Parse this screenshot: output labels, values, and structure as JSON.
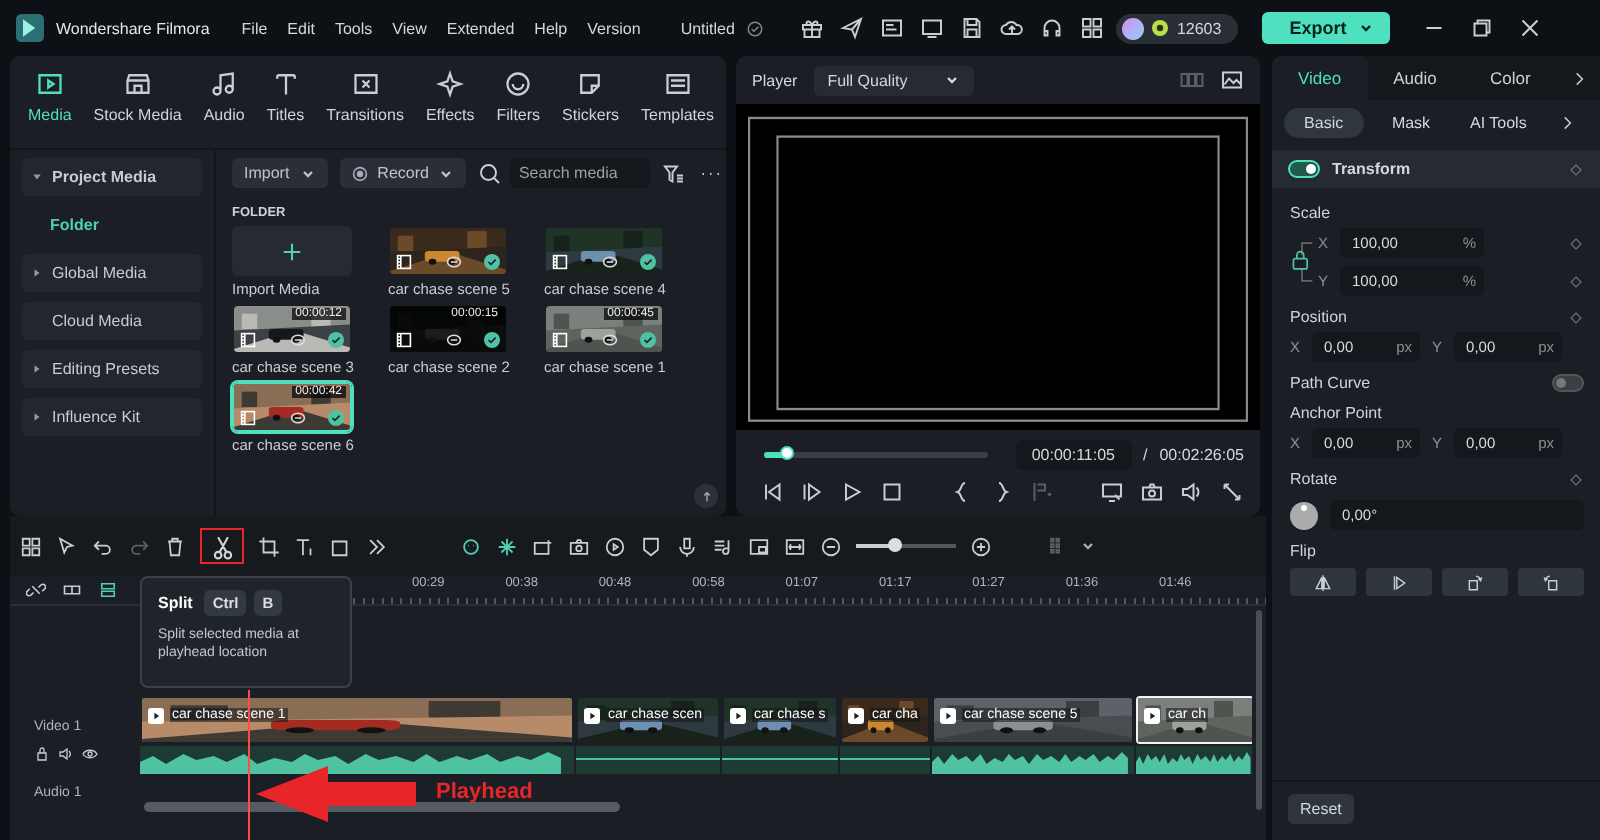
{
  "app": {
    "title": "Wondershare Filmora",
    "menu": [
      "File",
      "Edit",
      "Tools",
      "View",
      "Extended",
      "Help",
      "Version"
    ],
    "project": "Untitled",
    "credits": "12603",
    "export": "Export"
  },
  "media_tabs": [
    {
      "label": "Media",
      "selected": true
    },
    {
      "label": "Stock Media",
      "selected": false
    },
    {
      "label": "Audio",
      "selected": false
    },
    {
      "label": "Titles",
      "selected": false
    },
    {
      "label": "Transitions",
      "selected": false
    },
    {
      "label": "Effects",
      "selected": false
    },
    {
      "label": "Filters",
      "selected": false
    },
    {
      "label": "Stickers",
      "selected": false
    },
    {
      "label": "Templates",
      "selected": false
    }
  ],
  "media_sidebar": [
    {
      "label": "Project Media",
      "expanded": true,
      "children": [
        {
          "label": "Folder",
          "selected": true
        }
      ]
    },
    {
      "label": "Global Media",
      "expanded": false
    },
    {
      "label": "Cloud Media"
    },
    {
      "label": "Editing Presets",
      "expanded": false
    },
    {
      "label": "Influence Kit",
      "expanded": false
    }
  ],
  "media_toolbar": {
    "import": "Import",
    "record": "Record",
    "search_placeholder": "Search media"
  },
  "folder": {
    "heading": "FOLDER",
    "items": [
      {
        "kind": "import",
        "label": "Import Media"
      },
      {
        "kind": "clip",
        "label": "car chase scene 5",
        "selected": false
      },
      {
        "kind": "clip",
        "label": "car chase scene 4",
        "selected": false
      },
      {
        "kind": "clip",
        "label": "car chase scene 3",
        "duration": "00:00:12",
        "selected": false
      },
      {
        "kind": "clip",
        "label": "car chase scene 2",
        "duration": "00:00:15",
        "selected": false
      },
      {
        "kind": "clip",
        "label": "car chase scene 1",
        "duration": "00:00:45",
        "selected": false
      },
      {
        "kind": "clip",
        "label": "car chase scene 6",
        "duration": "00:00:42",
        "selected": true
      }
    ]
  },
  "player": {
    "label": "Player",
    "quality": "Full Quality",
    "level": 0.1,
    "current": "00:00:11:05",
    "separator": "/",
    "total": "00:02:26:05"
  },
  "split_button": {
    "highlighted": true
  },
  "tooltip": {
    "title": "Split",
    "keys": [
      "Ctrl",
      "B"
    ],
    "text": "Split selected media at playhead location"
  },
  "timeline": {
    "zoom": {
      "level": 0.38
    },
    "ruler": [
      "00:29",
      "00:38",
      "00:48",
      "00:58",
      "01:07",
      "01:17",
      "01:27",
      "01:36",
      "01:46"
    ],
    "tracks": [
      {
        "kind": "video",
        "label": "Video 1"
      },
      {
        "kind": "audio",
        "label": "Audio 1"
      }
    ],
    "clips": [
      {
        "label": "car chase scene 1",
        "selected": false,
        "audio_waveform": true
      },
      {
        "label": "car chase scen",
        "selected": false,
        "audio_waveform": false
      },
      {
        "label": "car chase s",
        "selected": false,
        "audio_waveform": false
      },
      {
        "label": "car cha",
        "selected": false,
        "audio_waveform": false
      },
      {
        "label": "car chase scene 5",
        "selected": false,
        "audio_waveform": true
      },
      {
        "label": "car ch",
        "selected": true,
        "audio_waveform": true
      }
    ],
    "annotation": "Playhead"
  },
  "inspector": {
    "tabs": [
      {
        "label": "Video",
        "selected": true
      },
      {
        "label": "Audio",
        "selected": false
      },
      {
        "label": "Color",
        "selected": false
      }
    ],
    "subtabs": [
      {
        "label": "Basic",
        "selected": true
      },
      {
        "label": "Mask",
        "selected": false
      },
      {
        "label": "AI Tools",
        "selected": false
      }
    ],
    "transform": {
      "label": "Transform",
      "on": true
    },
    "scale": {
      "label": "Scale",
      "fields": [
        {
          "axis": "X",
          "value": "100,00",
          "unit": "%"
        },
        {
          "axis": "Y",
          "value": "100,00",
          "unit": "%"
        }
      ]
    },
    "position": {
      "label": "Position",
      "fields": [
        {
          "axis": "X",
          "value": "0,00",
          "unit": "px"
        },
        {
          "axis": "Y",
          "value": "0,00",
          "unit": "px"
        }
      ]
    },
    "path_curve": {
      "label": "Path Curve",
      "on": false
    },
    "anchor": {
      "label": "Anchor Point",
      "fields": [
        {
          "axis": "X",
          "value": "0,00",
          "unit": "px"
        },
        {
          "axis": "Y",
          "value": "0,00",
          "unit": "px"
        }
      ]
    },
    "rotate": {
      "label": "Rotate",
      "value": "0,00°"
    },
    "flip": {
      "label": "Flip"
    },
    "reset": "Reset"
  }
}
